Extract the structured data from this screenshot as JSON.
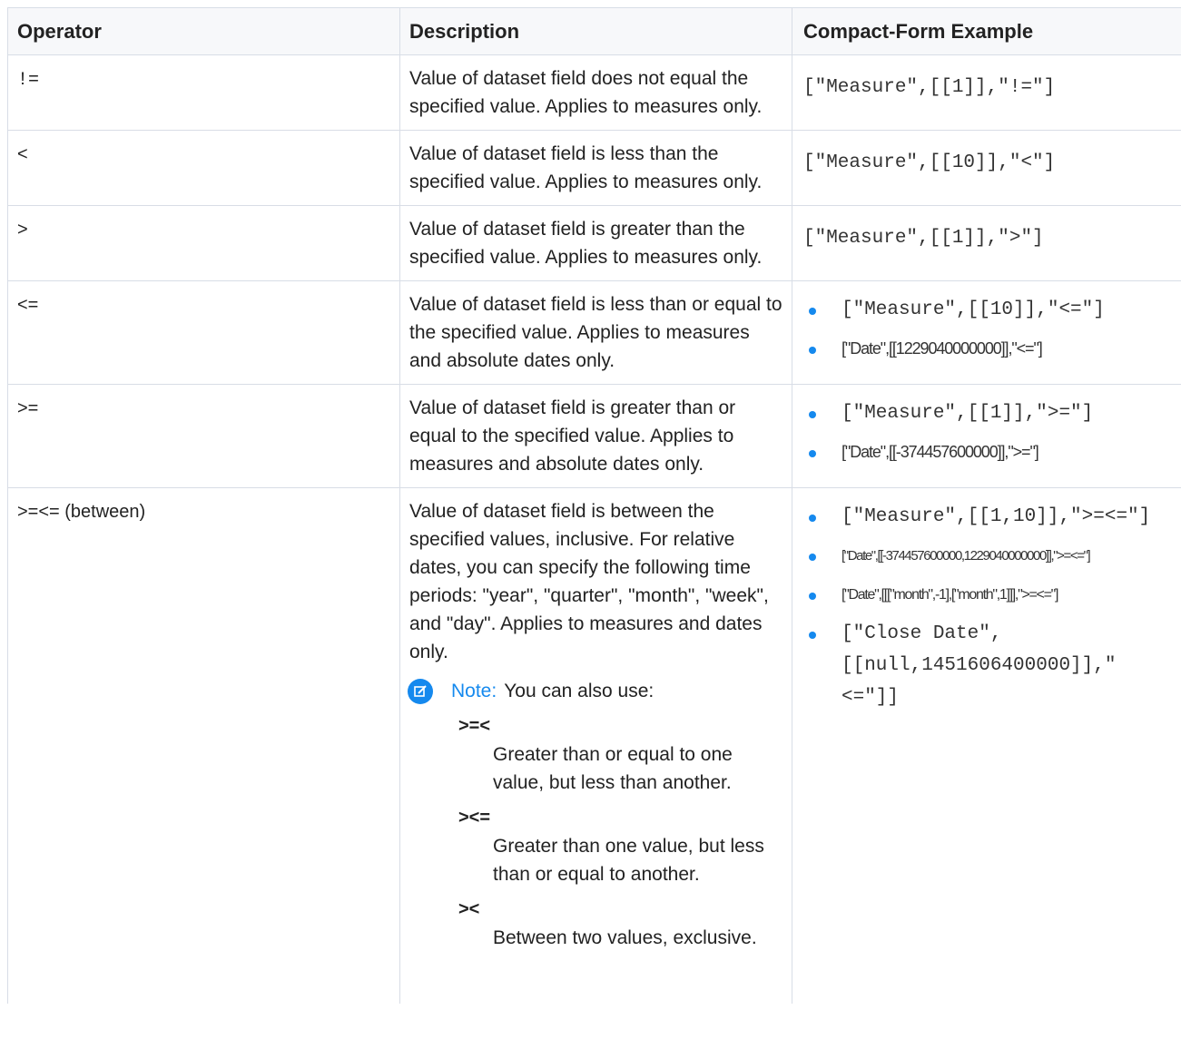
{
  "headers": {
    "operator": "Operator",
    "description": "Description",
    "example": "Compact-Form Example"
  },
  "rows": [
    {
      "operator": "!=",
      "description": "Value of dataset field does not equal the specified value. Applies to measures only.",
      "examples": [
        "[\"Measure\",[[1]],\"!=\"]"
      ]
    },
    {
      "operator": "<",
      "description": "Value of dataset field is less than the specified value. Applies to measures only.",
      "examples": [
        "[\"Measure\",[[10]],\"<\"]"
      ]
    },
    {
      "operator": ">",
      "description": "Value of dataset field is greater than the specified value. Applies to measures only.",
      "examples": [
        "[\"Measure\",[[1]],\">\"]"
      ]
    },
    {
      "operator": "<=",
      "description": "Value of dataset field is less than or equal to the specified value. Applies to measures and absolute dates only.",
      "examples": [
        "[\"Measure\",[[10]],\"<=\"]",
        "[\"Date\",[[1229040000000]],\"<=\"]"
      ]
    },
    {
      "operator": ">=",
      "description": "Value of dataset field is greater than or equal to the specified value. Applies to measures and absolute dates only.",
      "examples": [
        "[\"Measure\",[[1]],\">=\"]",
        "[\"Date\",[[-374457600000]],\">=\"]"
      ]
    },
    {
      "operator": ">=<= (between)",
      "description": "Value of dataset field is between the specified values, inclusive. For relative dates, you can specify the following time periods: \"year\", \"quarter\", \"month\", \"week\", and \"day\". Applies to measures and dates only.",
      "note": {
        "label": "Note:",
        "text": "You can also use:",
        "terms": [
          {
            "term": ">=<",
            "definition": "Greater than or equal to one value, but less than another."
          },
          {
            "term": "><=",
            "definition": "Greater than one value, but less than or equal to another."
          },
          {
            "term": "><",
            "definition": "Between two values, exclusive."
          }
        ]
      },
      "examples": [
        "[\"Measure\",[[1,10]],\">=<=\"]",
        "[\"Date\",[[-374457600000,1229040000000]],\">=<=\"]",
        "[\"Date\",[[[\"month\",-1],[\"month\",1]]],\">=<=\"]",
        "[\"Close Date\", [[null,1451606400000]],\"<=\"]]"
      ]
    }
  ],
  "colors": {
    "border": "#d8dde6",
    "accent": "#1589ee",
    "text": "#222222"
  },
  "icons": {
    "note": "edit-note-icon",
    "bullet": "bullet-dot-icon"
  }
}
